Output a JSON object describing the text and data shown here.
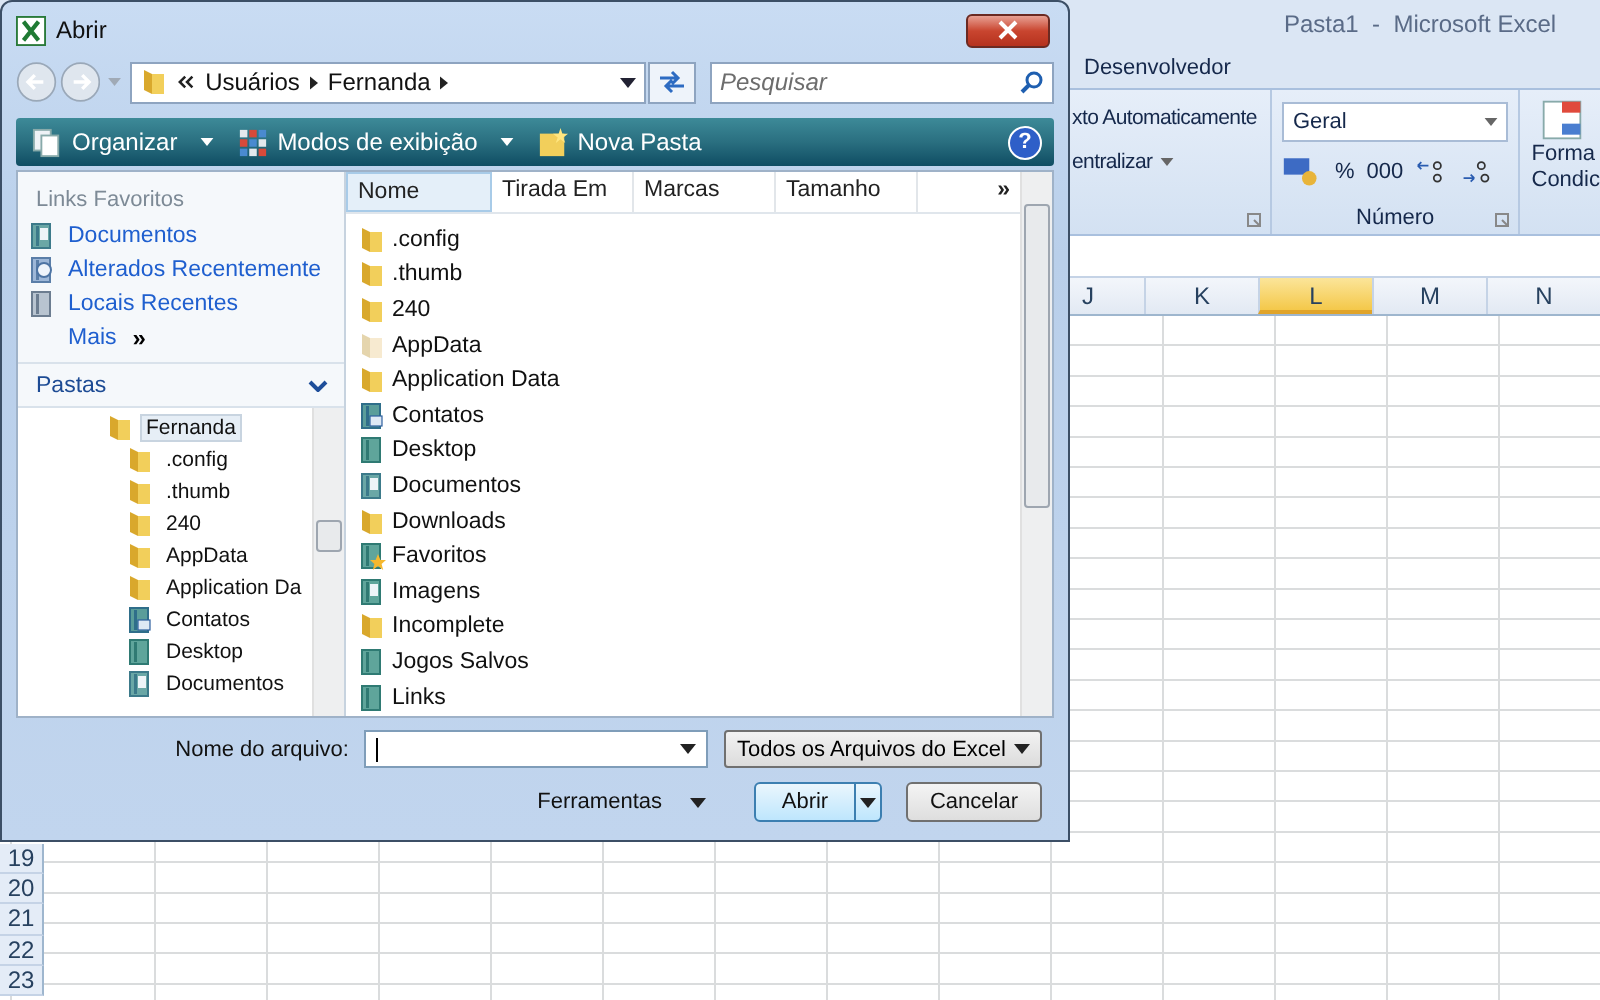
{
  "excel": {
    "title": "Pasta1  -  Microsoft Excel",
    "tabs": [
      {
        "label": "Desenvolvedor",
        "selected": false
      }
    ],
    "ribbon": {
      "alignment_items": [
        {
          "label": "xto Automaticamente",
          "dropdown": false
        },
        {
          "label": "entralizar",
          "dropdown": true
        }
      ],
      "number_format": "Geral",
      "percent": "%",
      "thousands": "000",
      "number_group_label": "Número",
      "styles_button": [
        "Forma",
        "Condic"
      ]
    },
    "columns": [
      {
        "label": "J",
        "selected": false
      },
      {
        "label": "K",
        "selected": false
      },
      {
        "label": "L",
        "selected": true
      },
      {
        "label": "M",
        "selected": false
      },
      {
        "label": "N",
        "selected": false
      }
    ],
    "rows": [
      "19",
      "20",
      "21",
      "22",
      "23"
    ]
  },
  "dialog": {
    "title": "Abrir",
    "address": [
      "Usuários",
      "Fernanda"
    ],
    "search": {
      "placeholder": "Pesquisar"
    },
    "toolbar": [
      {
        "label": "Organizar",
        "kind": "organize",
        "dropdown": true
      },
      {
        "label": "Modos de exibição",
        "kind": "views",
        "dropdown": true
      },
      {
        "label": "Nova Pasta",
        "kind": "new-folder",
        "dropdown": false
      }
    ],
    "help": "?",
    "favorites_header": "Links Favoritos",
    "favorites": [
      {
        "label": "Documentos",
        "kind": "documents"
      },
      {
        "label": "Alterados Recentemente",
        "kind": "recent"
      },
      {
        "label": "Locais Recentes",
        "kind": "places"
      }
    ],
    "more": {
      "label": "Mais",
      "arrow": "»"
    },
    "folders_header": "Pastas",
    "tree": [
      {
        "label": "Fernanda",
        "kind": "folder",
        "selected": true,
        "children": [
          {
            "label": ".config",
            "kind": "folder",
            "selected": false
          },
          {
            "label": ".thumb",
            "kind": "folder",
            "selected": false
          },
          {
            "label": "240",
            "kind": "folder",
            "selected": false
          },
          {
            "label": "AppData",
            "kind": "folder",
            "selected": false
          },
          {
            "label": "Application Da",
            "kind": "folder",
            "selected": false
          },
          {
            "label": "Contatos",
            "kind": "contacts",
            "selected": false
          },
          {
            "label": "Desktop",
            "kind": "library",
            "selected": false
          },
          {
            "label": "Documentos",
            "kind": "documents",
            "selected": false
          }
        ]
      }
    ],
    "columns": [
      {
        "label": "Nome",
        "selected": true
      },
      {
        "label": "Tirada Em",
        "selected": false
      },
      {
        "label": "Marcas",
        "selected": false
      },
      {
        "label": "Tamanho",
        "selected": false
      }
    ],
    "columns_more": "»",
    "files": [
      {
        "name": ".config",
        "kind": "folder"
      },
      {
        "name": ".thumb",
        "kind": "folder"
      },
      {
        "name": "240",
        "kind": "folder"
      },
      {
        "name": "AppData",
        "kind": "hidden-folder"
      },
      {
        "name": "Application Data",
        "kind": "folder"
      },
      {
        "name": "Contatos",
        "kind": "contacts"
      },
      {
        "name": "Desktop",
        "kind": "library"
      },
      {
        "name": "Documentos",
        "kind": "documents"
      },
      {
        "name": "Downloads",
        "kind": "folder"
      },
      {
        "name": "Favoritos",
        "kind": "favorites"
      },
      {
        "name": "Imagens",
        "kind": "pictures"
      },
      {
        "name": "Incomplete",
        "kind": "folder"
      },
      {
        "name": "Jogos Salvos",
        "kind": "library"
      },
      {
        "name": "Links",
        "kind": "library"
      }
    ],
    "filename_label": "Nome do arquivo:",
    "filetype": "Todos os Arquivos do Excel",
    "tools": "Ferramentas",
    "buttons": [
      {
        "label": "Abrir",
        "kind": "split",
        "default": true
      },
      {
        "label": "Cancelar",
        "kind": "plain",
        "default": false
      }
    ]
  }
}
